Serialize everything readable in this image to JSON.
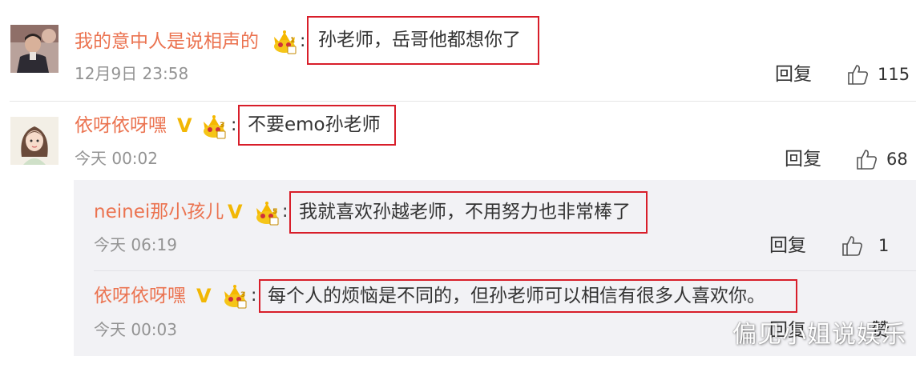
{
  "colors": {
    "username": "#eb7350",
    "text": "#333333",
    "time": "#939393",
    "highlight_border": "#d81e2a",
    "reply_panel_bg": "#f2f2f5",
    "verified_badge": "#f2b705"
  },
  "comments": [
    {
      "username": "我的意中人是说相声的",
      "colon": ":",
      "badge_level": "1",
      "text": "孙老师，岳哥他都想你了",
      "time": "12月9日 23:58",
      "reply_label": "回复",
      "likes": "115"
    },
    {
      "username": "依呀依呀嘿",
      "verified": "V",
      "colon": ":",
      "badge_level": "3",
      "text": "不要emo孙老师",
      "time": "今天 00:02",
      "reply_label": "回复",
      "likes": "68"
    }
  ],
  "replies": [
    {
      "username": "neinei那小孩儿",
      "verified": "V",
      "colon": ":",
      "badge_level": "5",
      "text": "我就喜欢孙越老师，不用努力也非常棒了",
      "time": "今天 06:19",
      "reply_label": "回复",
      "likes": "1"
    },
    {
      "username": "依呀依呀嘿",
      "verified": "V",
      "colon": ":",
      "badge_level": "3",
      "text": "每个人的烦恼是不同的，但孙老师可以相信有很多人喜欢你。",
      "time": "今天 00:03",
      "reply_label": "回复",
      "likes_label": "赞"
    }
  ],
  "watermark": "偏见小姐说娱乐"
}
